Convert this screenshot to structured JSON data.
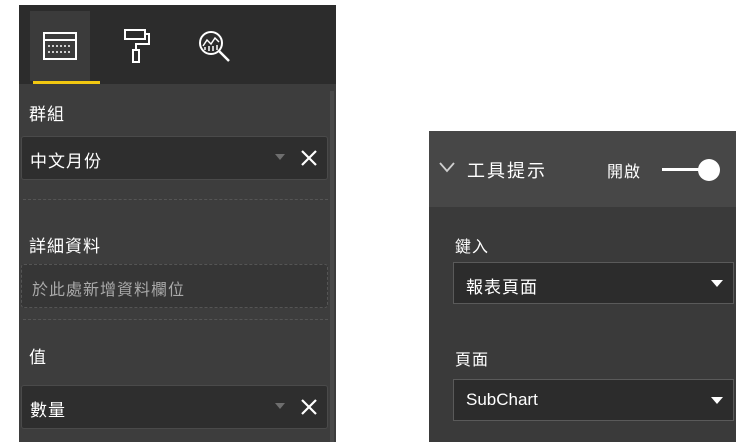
{
  "fields_pane": {
    "toolbar": {
      "buttons": [
        {
          "icon": "fields-icon",
          "active": true
        },
        {
          "icon": "paint-roller-icon",
          "active": false
        },
        {
          "icon": "analytics-icon",
          "active": false
        }
      ],
      "accent_color": "#f2c811"
    },
    "group": {
      "label": "群組",
      "chip": "中文月份"
    },
    "details": {
      "label": "詳細資料",
      "placeholder": "於此處新增資料欄位"
    },
    "values": {
      "label": "值",
      "chip": "數量"
    }
  },
  "format_pane": {
    "tooltip_section": {
      "title": "工具提示",
      "state": "開啟",
      "toggle_on": true
    },
    "type": {
      "label": "鍵入",
      "value": "報表頁面"
    },
    "page": {
      "label": "頁面",
      "value": "SubChart"
    }
  }
}
